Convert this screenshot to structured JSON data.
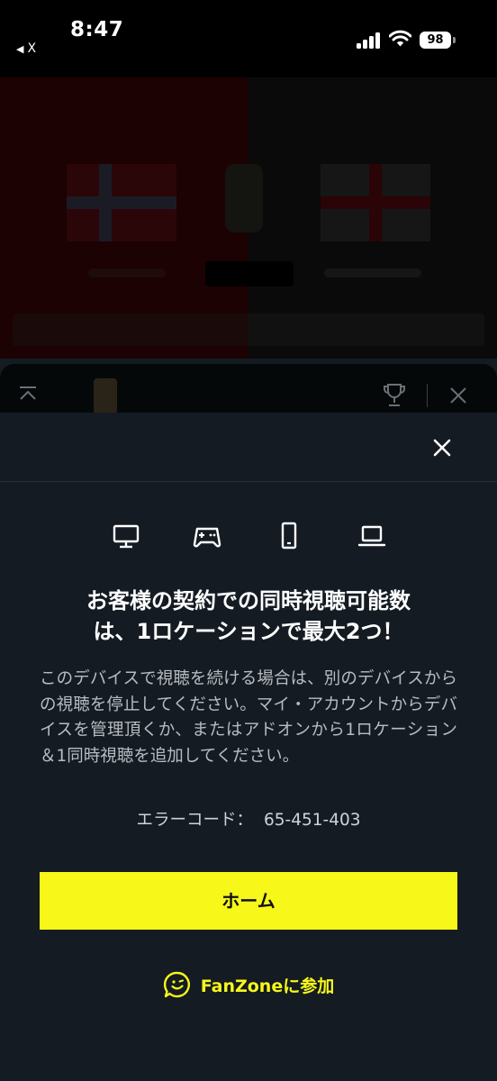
{
  "status_bar": {
    "time": "8:47",
    "back_app": "X",
    "battery": "98"
  },
  "modal": {
    "title_line1": "お客様の契約での同時視聴可能数",
    "title_line2": "は、1ロケーションで最大2つ！",
    "body": "このデバイスで視聴を続ける場合は、別のデバイスからの視聴を停止してください。マイ・アカウントからデバイスを管理頂くか、またはアドオンから1ロケーション＆1同時視聴を追加してください。",
    "error_label": "エラーコード：",
    "error_code": "65-451-403",
    "home_button": "ホーム",
    "fanzone_label": "FanZoneに参加",
    "device_icons": [
      "desktop-icon",
      "game-controller-icon",
      "smartphone-icon",
      "laptop-icon"
    ]
  },
  "colors": {
    "accent": "#f7f71a",
    "modal_background": "#141b22",
    "body_text": "#b8bcc1"
  }
}
